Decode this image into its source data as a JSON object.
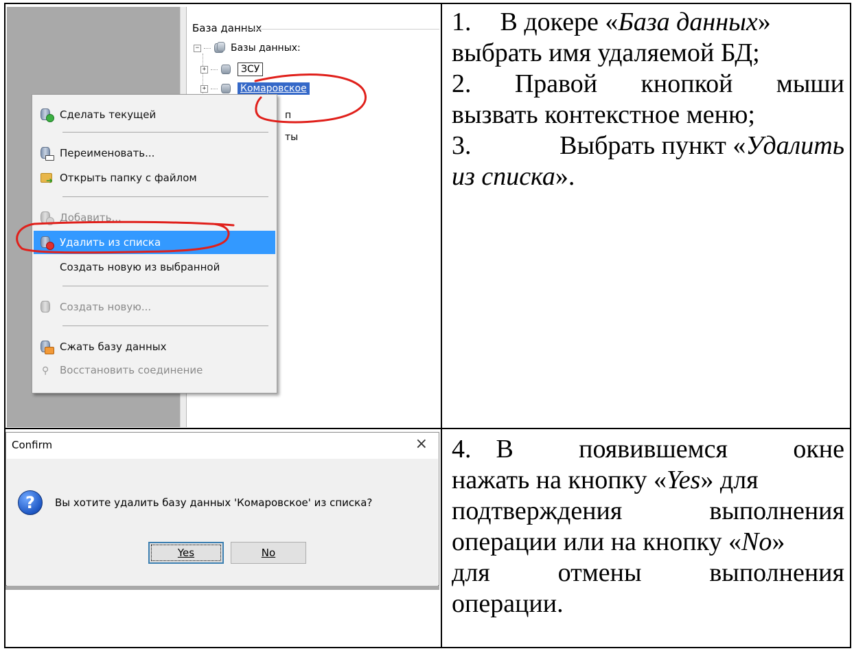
{
  "screenshot1": {
    "dock_title": "База данных",
    "tree_root_label": "Базы данных:",
    "tree_item_1": "ЗСУ",
    "tree_item_2_selected": "Комаровское",
    "fragment_1": "п",
    "fragment_2": "ты",
    "context_menu": {
      "items": [
        {
          "label": "Сделать текущей",
          "enabled": true,
          "icon": "db-make-current-icon"
        },
        {
          "label": "Переименовать...",
          "enabled": true,
          "icon": "db-rename-icon"
        },
        {
          "label": "Открыть папку с файлом",
          "enabled": true,
          "icon": "open-folder-icon"
        },
        {
          "label": "Добавить...",
          "enabled": false,
          "icon": "db-add-icon"
        },
        {
          "label": "Удалить из списка",
          "enabled": true,
          "highlighted": true,
          "icon": "db-remove-icon"
        },
        {
          "label": "Создать новую из выбранной",
          "enabled": true,
          "icon": ""
        },
        {
          "label": "Создать новую...",
          "enabled": false,
          "icon": "db-create-icon"
        },
        {
          "label": "Сжать базу данных",
          "enabled": true,
          "icon": "db-compress-icon"
        },
        {
          "label": "Восстановить соединение",
          "enabled": false,
          "icon": "restore-connection-icon"
        }
      ]
    }
  },
  "dialog": {
    "title": "Confirm",
    "close_glyph": "×",
    "message": "Вы хотите удалить базу данных 'Комаровское' из списка?",
    "yes_label": "Yes",
    "no_label": "No"
  },
  "instructions": {
    "step1": {
      "num": "1.",
      "a": "В докере «",
      "b": "База данных",
      "c": "»",
      "d": "выбрать имя удаляемой БД;"
    },
    "step2": {
      "num": "2.",
      "a": "Правой",
      "b": "кнопкой",
      "c": "мыши",
      "d": "вызвать контекстное меню;"
    },
    "step3": {
      "num": "3.",
      "a": "Выбрать пункт «",
      "b": "Удалить",
      "c": "из списка",
      "d": "»."
    },
    "step4": {
      "num": "4.",
      "w1": "В",
      "w2": "появившемся",
      "w3": "окне",
      "l2a": "нажать на кнопку «",
      "l2b": "Yes",
      "l2c": "» для",
      "l3a": "подтверждения",
      "l3b": "выполнения",
      "l4a": "операции или на кнопку «",
      "l4b": "No",
      "l4c": "»",
      "l5a": "для",
      "l5b": "отмены",
      "l5c": "выполнения",
      "l6": "операции."
    }
  },
  "colors": {
    "highlight": "#3399ff",
    "markup_red": "#e0201b",
    "selected_node": "#3468c8"
  }
}
